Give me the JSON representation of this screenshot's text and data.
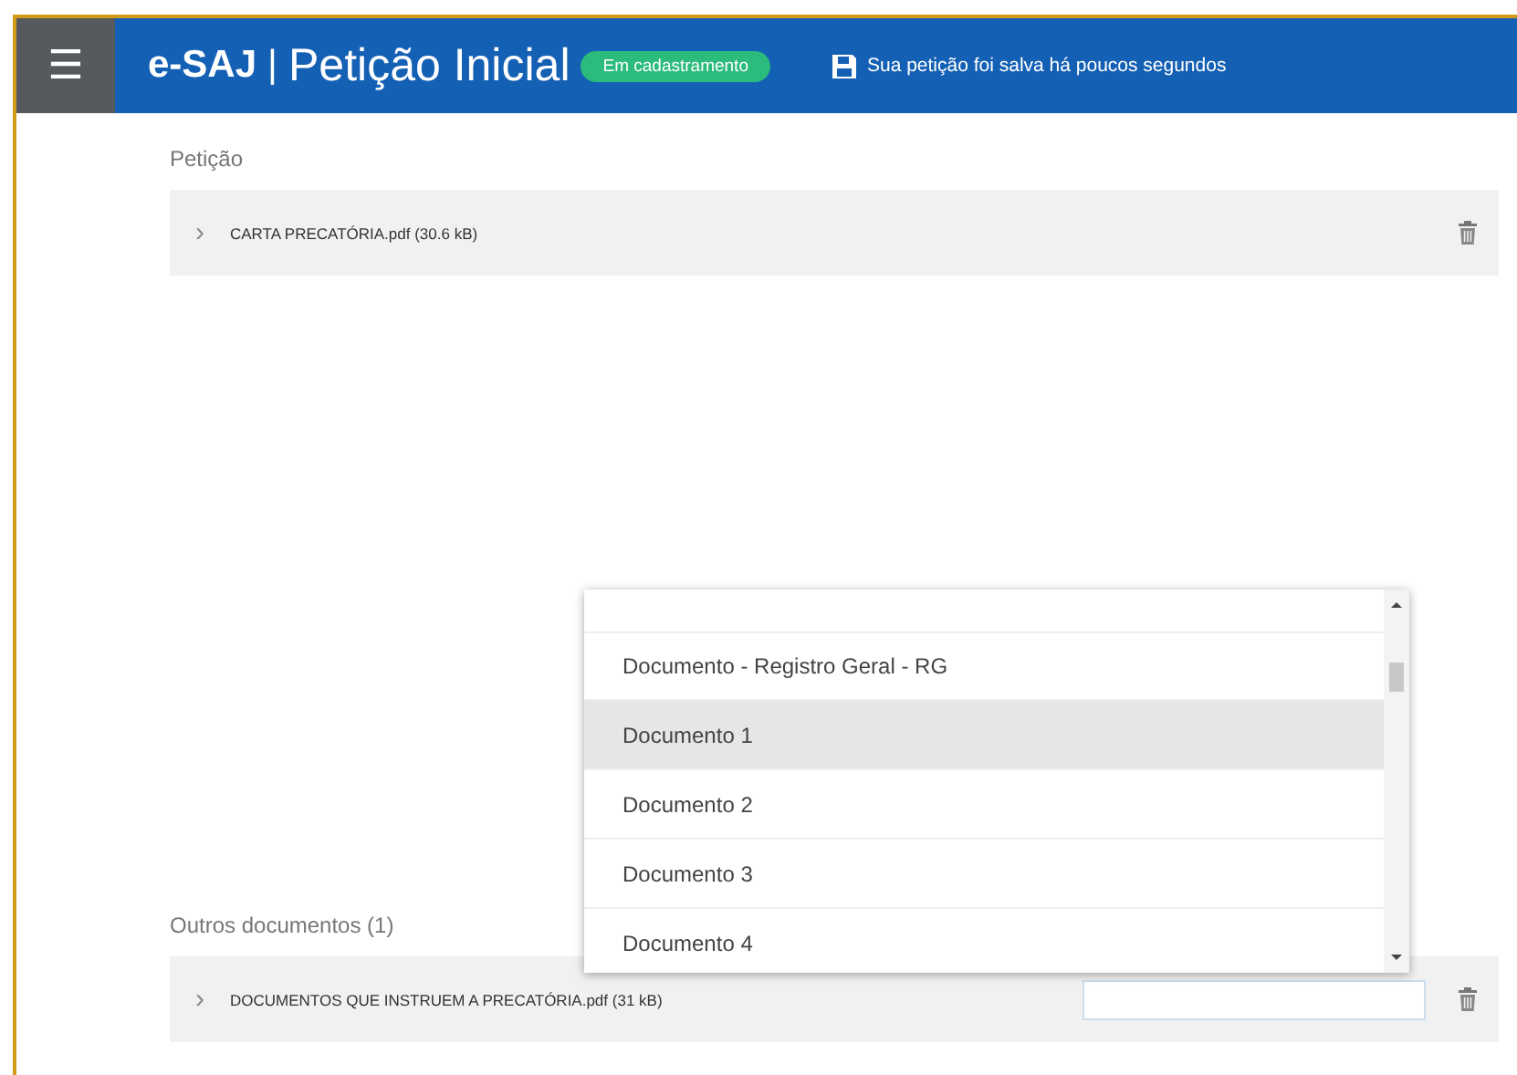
{
  "header": {
    "menu_icon": "☰",
    "brand": "e-SAJ",
    "separator": "|",
    "title": "Petição Inicial",
    "status_badge": "Em cadastramento",
    "save_message": "Sua petição foi salva há poucos segundos"
  },
  "sections": [
    {
      "label": "Petição",
      "files": [
        {
          "chevron": "›",
          "name": "CARTA PRECATÓRIA.pdf (30.6 kB)"
        }
      ]
    },
    {
      "label": "Outros documentos (1)",
      "files": [
        {
          "chevron": "›",
          "name": "DOCUMENTOS QUE INSTRUEM A PRECATÓRIA.pdf (31 kB)",
          "kind": "with_type_field"
        }
      ]
    }
  ],
  "dropdown": {
    "options": [
      {
        "label": "Documento - Registro Geral - RG",
        "selected": false
      },
      {
        "label": "Documento 1",
        "selected": true
      },
      {
        "label": "Documento 2",
        "selected": false
      },
      {
        "label": "Documento 3",
        "selected": false
      },
      {
        "label": "Documento 4",
        "selected": false
      }
    ]
  }
}
